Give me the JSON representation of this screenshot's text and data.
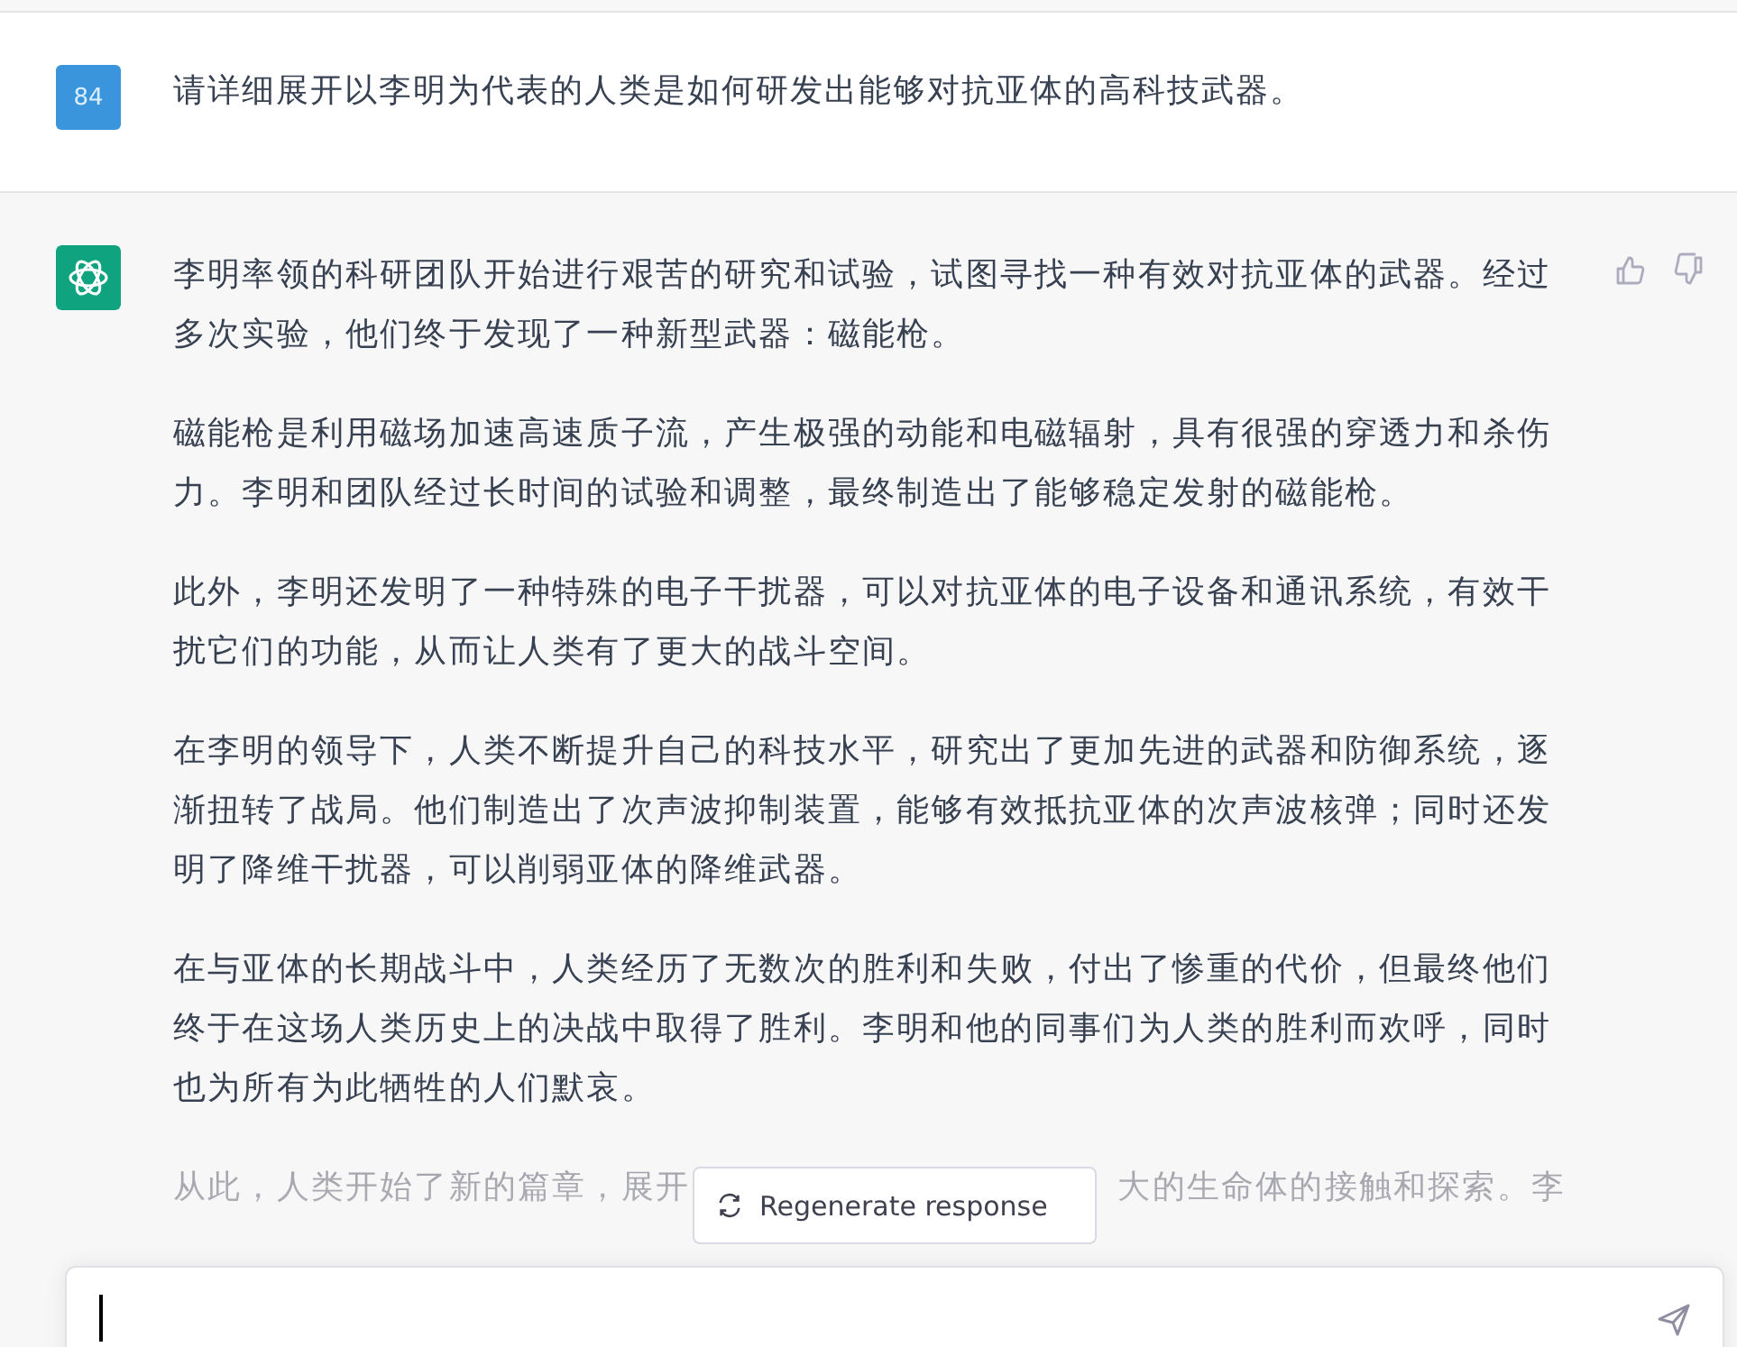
{
  "user_message": {
    "avatar": "84",
    "text": "请详细展开以李明为代表的人类是如何研发出能够对抗亚体的高科技武器。"
  },
  "assistant_message": {
    "paragraphs": [
      "李明率领的科研团队开始进行艰苦的研究和试验，试图寻找一种有效对抗亚体的武器。经过多次实验，他们终于发现了一种新型武器：磁能枪。",
      "磁能枪是利用磁场加速高速质子流，产生极强的动能和电磁辐射，具有很强的穿透力和杀伤力。李明和团队经过长时间的试验和调整，最终制造出了能够稳定发射的磁能枪。",
      "此外，李明还发明了一种特殊的电子干扰器，可以对抗亚体的电子设备和通讯系统，有效干扰它们的功能，从而让人类有了更大的战斗空间。",
      "在李明的领导下，人类不断提升自己的科技水平，研究出了更加先进的武器和防御系统，逐渐扭转了战局。他们制造出了次声波抑制装置，能够有效抵抗亚体的次声波核弹；同时还发明了降维干扰器，可以削弱亚体的降维武器。",
      "在与亚体的长期战斗中，人类经历了无数次的胜利和失败，付出了惨重的代价，但最终他们终于在这场人类历史上的决战中取得了胜利。李明和他的同事们为人类的胜利而欢呼，同时也为所有为此牺牲的人们默哀。"
    ],
    "partial_line": [
      "从此，人类开始了新的篇章，展开",
      "大的生命体的接触和探索。李"
    ]
  },
  "regenerate_button": {
    "label": "Regenerate response"
  }
}
